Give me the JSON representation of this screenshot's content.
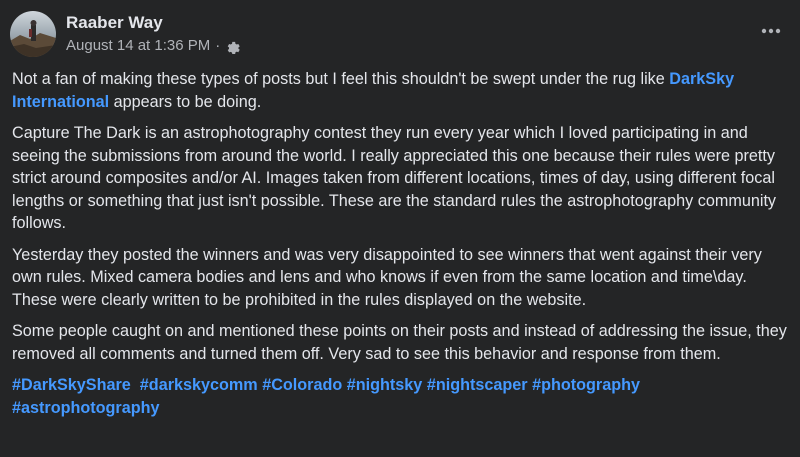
{
  "post": {
    "author": "Raaber Way",
    "timestamp": "August 14 at 1:36 PM",
    "separator": "·",
    "audience_icon": "gear-icon",
    "more_icon": "more-options-icon"
  },
  "content": {
    "p1_before": "Not a fan of making these types of posts but I feel this shouldn't be swept under the rug like ",
    "p1_link": "DarkSky International",
    "p1_after": "  appears to be doing.",
    "p2": "Capture The Dark is an astrophotography contest they run every year which I loved participating in and seeing the submissions from around the world. I really appreciated this one because their rules were pretty strict around composites and/or AI. Images taken from different locations, times of day, using different focal lengths or something that just isn't possible. These are the standard rules the astrophotography community follows.",
    "p3": "Yesterday they posted the winners and was very disappointed to see winners that went against their very own rules. Mixed camera bodies and lens and who knows if even from the same location and time\\day. These were clearly written to be prohibited in the rules displayed on the website.",
    "p4": "Some people caught on and mentioned these points on their posts and instead of addressing the issue, they removed all comments and turned them off. Very sad to see this behavior and response from them.",
    "hashtags": [
      "#DarkSkyShare",
      "#darkskycomm",
      "#Colorado",
      "#nightsky",
      "#nightscaper",
      "#photography",
      "#astrophotography"
    ]
  },
  "colors": {
    "background": "#242526",
    "text": "#e4e6eb",
    "secondary_text": "#b0b3b8",
    "link": "#4599ff"
  }
}
